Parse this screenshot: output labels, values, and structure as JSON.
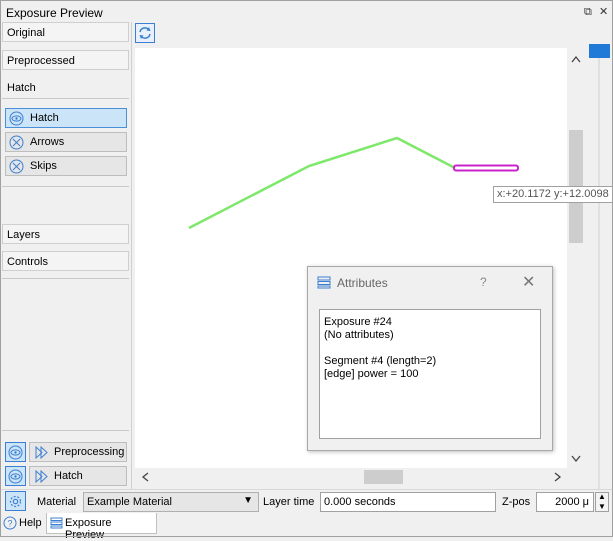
{
  "window": {
    "title": "Exposure Preview"
  },
  "sidebar": {
    "sections": {
      "original": "Original",
      "preprocessed": "Preprocessed",
      "hatch": "Hatch",
      "layers": "Layers",
      "controls": "Controls"
    },
    "hatch_buttons": {
      "hatch": "Hatch",
      "arrows": "Arrows",
      "skips": "Skips"
    },
    "bottom_buttons": {
      "preprocessing": "Preprocessing",
      "hatch": "Hatch"
    }
  },
  "viewport": {
    "coord_tooltip": "x:+20.1172 y:+12.0098"
  },
  "attributes_dialog": {
    "title": "Attributes",
    "help": "?",
    "lines": [
      "Exposure #24",
      "(No attributes)",
      "",
      "Segment #4 (length=2)",
      "[edge] power = 100"
    ]
  },
  "bottom_bar": {
    "material_label": "Material",
    "material_value": "Example Material",
    "layer_time_label": "Layer time",
    "layer_time_value": "0.000 seconds",
    "zpos_label": "Z-pos",
    "zpos_value": "2000 μ"
  },
  "tabs": {
    "help": "Help",
    "exposure_preview": "Exposure Preview"
  },
  "colors": {
    "path_line": "#7de86a",
    "selected_segment": "#cc22cc",
    "accent": "#3c7fd1"
  }
}
